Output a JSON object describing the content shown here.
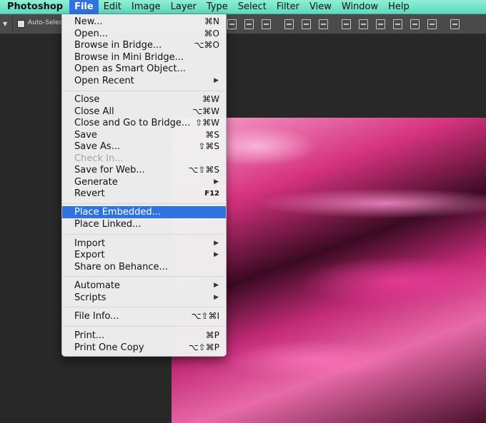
{
  "menubar": {
    "app_name": "Photoshop",
    "items": [
      "File",
      "Edit",
      "Image",
      "Layer",
      "Type",
      "Select",
      "Filter",
      "View",
      "Window",
      "Help"
    ]
  },
  "options_bar": {
    "auto_select_label": "Auto-Select:"
  },
  "file_menu": {
    "items": [
      {
        "label": "New...",
        "shortcut": "⌘N"
      },
      {
        "label": "Open...",
        "shortcut": "⌘O"
      },
      {
        "label": "Browse in Bridge...",
        "shortcut": "⌥⌘O"
      },
      {
        "label": "Browse in Mini Bridge...",
        "shortcut": ""
      },
      {
        "label": "Open as Smart Object...",
        "shortcut": ""
      },
      {
        "label": "Open Recent",
        "shortcut": "",
        "submenu": true
      },
      {
        "label": "Close",
        "shortcut": "⌘W"
      },
      {
        "label": "Close All",
        "shortcut": "⌥⌘W"
      },
      {
        "label": "Close and Go to Bridge...",
        "shortcut": "⇧⌘W"
      },
      {
        "label": "Save",
        "shortcut": "⌘S"
      },
      {
        "label": "Save As...",
        "shortcut": "⇧⌘S"
      },
      {
        "label": "Check In...",
        "shortcut": "",
        "disabled": true
      },
      {
        "label": "Save for Web...",
        "shortcut": "⌥⇧⌘S"
      },
      {
        "label": "Generate",
        "shortcut": "",
        "submenu": true
      },
      {
        "label": "Revert",
        "shortcut": "F12"
      },
      {
        "label": "Place Embedded...",
        "shortcut": "",
        "highlighted": true
      },
      {
        "label": "Place Linked...",
        "shortcut": ""
      },
      {
        "label": "Import",
        "shortcut": "",
        "submenu": true
      },
      {
        "label": "Export",
        "shortcut": "",
        "submenu": true
      },
      {
        "label": "Share on Behance...",
        "shortcut": ""
      },
      {
        "label": "Automate",
        "shortcut": "",
        "submenu": true
      },
      {
        "label": "Scripts",
        "shortcut": "",
        "submenu": true
      },
      {
        "label": "File Info...",
        "shortcut": "⌥⇧⌘I"
      },
      {
        "label": "Print...",
        "shortcut": "⌘P"
      },
      {
        "label": "Print One Copy",
        "shortcut": "⌥⇧⌘P"
      }
    ]
  },
  "colors": {
    "menubar": "#5ed9bd",
    "highlight": "#2e73e0",
    "workspace": "#282828"
  }
}
